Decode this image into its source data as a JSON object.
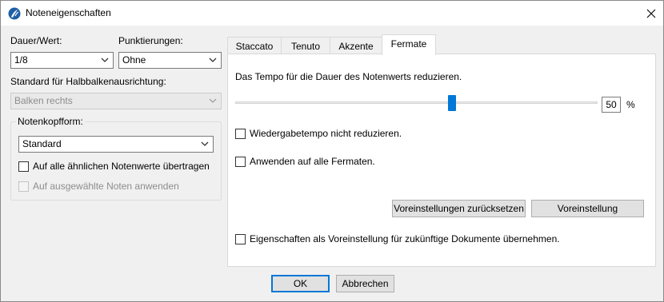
{
  "window": {
    "title": "Noteneigenschaften",
    "close_glyph": "✕"
  },
  "left": {
    "dauer_label": "Dauer/Wert:",
    "dauer_value": "1/8",
    "punkt_label": "Punktierungen:",
    "punkt_value": "Ohne",
    "halbbalken_label": "Standard für Halbbalkenausrichtung:",
    "halbbalken_value": "Balken rechts",
    "notenkopf": {
      "title": "Notenkopfform:",
      "value": "Standard",
      "check1_label": "Auf alle ähnlichen Notenwerte übertragen",
      "check1_checked": false,
      "check2_label": "Auf ausgewählte Noten anwenden",
      "check2_checked": false
    }
  },
  "tabs": [
    {
      "label": "Staccato",
      "active": false
    },
    {
      "label": "Tenuto",
      "active": false
    },
    {
      "label": "Akzente",
      "active": false
    },
    {
      "label": "Fermate",
      "active": true
    }
  ],
  "fermate": {
    "description": "Das Tempo für die Dauer des Notenwerts reduzieren.",
    "slider_value": 50,
    "slider_min": 0,
    "slider_max": 100,
    "value_text": "50",
    "unit": "%",
    "check_no_reduce_label": "Wiedergabetempo nicht reduzieren.",
    "check_no_reduce_checked": false,
    "check_all_fermatas_label": "Anwenden auf alle Fermaten.",
    "check_all_fermatas_checked": false,
    "reset_button": "Voreinstellungen zurücksetzen",
    "preset_button": "Voreinstellung",
    "check_default_label": "Eigenschaften als Voreinstellung für zukünftige Dokumente übernehmen.",
    "check_default_checked": false
  },
  "footer": {
    "ok": "OK",
    "cancel": "Abbrechen"
  },
  "colors": {
    "accent": "#0078d7",
    "window_bg": "#f0f0f0"
  },
  "icons": {
    "app": "app-logo-icon",
    "close": "close-icon",
    "dropdown": "chevron-down-icon"
  }
}
